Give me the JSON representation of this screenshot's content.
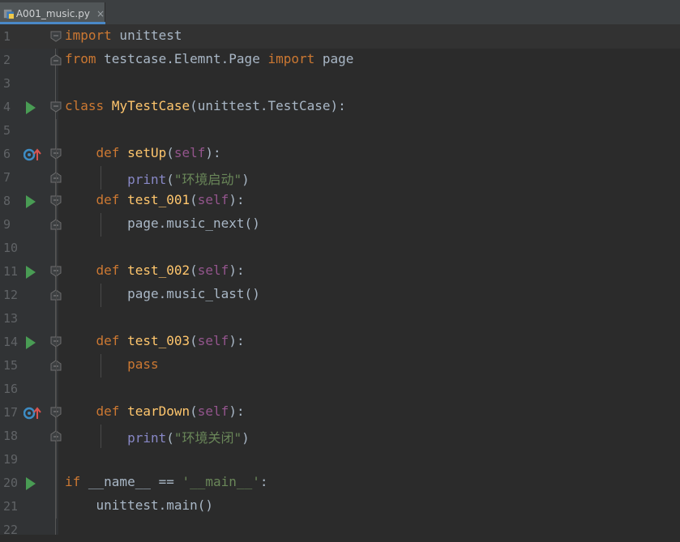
{
  "tab": {
    "file_name": "A001_music.py",
    "close_glyph": "×"
  },
  "colors": {
    "keyword": "#cc7832",
    "function": "#ffc66d",
    "self": "#94558d",
    "string": "#6a8759",
    "text": "#a9b7c6",
    "run": "#499c54"
  },
  "lines": [
    {
      "num": "1",
      "parts": [
        [
          "kw",
          "import"
        ],
        [
          "",
          " unittest"
        ]
      ]
    },
    {
      "num": "2",
      "parts": [
        [
          "kw",
          "from"
        ],
        [
          "",
          " testcase.Elemnt.Page "
        ],
        [
          "kw",
          "import"
        ],
        [
          "",
          " page"
        ]
      ]
    },
    {
      "num": "3",
      "parts": []
    },
    {
      "num": "4",
      "parts": [
        [
          "kw",
          "class"
        ],
        [
          "",
          " "
        ],
        [
          "fn",
          "MyTestCase"
        ],
        [
          "",
          "(unittest.TestCase):"
        ]
      ]
    },
    {
      "num": "5",
      "parts": []
    },
    {
      "num": "6",
      "parts": [
        [
          "",
          "    "
        ],
        [
          "kw",
          "def"
        ],
        [
          "",
          " "
        ],
        [
          "fn",
          "setUp"
        ],
        [
          "",
          "("
        ],
        [
          "self",
          "self"
        ],
        [
          "",
          "):"
        ]
      ]
    },
    {
      "num": "7",
      "parts": [
        [
          "",
          "        "
        ],
        [
          "builtin",
          "print"
        ],
        [
          "",
          "("
        ],
        [
          "str",
          "\"环境启动\""
        ],
        [
          "",
          ")"
        ]
      ]
    },
    {
      "num": "8",
      "parts": [
        [
          "",
          "    "
        ],
        [
          "kw",
          "def"
        ],
        [
          "",
          " "
        ],
        [
          "fn",
          "test_001"
        ],
        [
          "",
          "("
        ],
        [
          "self",
          "self"
        ],
        [
          "",
          "):"
        ]
      ]
    },
    {
      "num": "9",
      "parts": [
        [
          "",
          "        page.music_next("
        ],
        [
          "",
          ")"
        ]
      ]
    },
    {
      "num": "10",
      "parts": []
    },
    {
      "num": "11",
      "parts": [
        [
          "",
          "    "
        ],
        [
          "kw",
          "def"
        ],
        [
          "",
          " "
        ],
        [
          "fn",
          "test_002"
        ],
        [
          "",
          "("
        ],
        [
          "self",
          "self"
        ],
        [
          "",
          "):"
        ]
      ]
    },
    {
      "num": "12",
      "parts": [
        [
          "",
          "        page.music_last("
        ],
        [
          "",
          ")"
        ]
      ]
    },
    {
      "num": "13",
      "parts": []
    },
    {
      "num": "14",
      "parts": [
        [
          "",
          "    "
        ],
        [
          "kw",
          "def"
        ],
        [
          "",
          " "
        ],
        [
          "fn",
          "test_003"
        ],
        [
          "",
          "("
        ],
        [
          "self",
          "self"
        ],
        [
          "",
          "):"
        ]
      ]
    },
    {
      "num": "15",
      "parts": [
        [
          "",
          "        "
        ],
        [
          "kw",
          "pass"
        ]
      ]
    },
    {
      "num": "16",
      "parts": []
    },
    {
      "num": "17",
      "parts": [
        [
          "",
          "    "
        ],
        [
          "kw",
          "def"
        ],
        [
          "",
          " "
        ],
        [
          "fn",
          "tearDown"
        ],
        [
          "",
          "("
        ],
        [
          "self",
          "self"
        ],
        [
          "",
          "):"
        ]
      ]
    },
    {
      "num": "18",
      "parts": [
        [
          "",
          "        "
        ],
        [
          "builtin",
          "print"
        ],
        [
          "",
          "("
        ],
        [
          "str",
          "\"环境关闭\""
        ],
        [
          "",
          ")"
        ]
      ]
    },
    {
      "num": "19",
      "parts": []
    },
    {
      "num": "20",
      "parts": [
        [
          "kw",
          "if"
        ],
        [
          "",
          " __name__ == "
        ],
        [
          "str",
          "'__main__'"
        ],
        [
          "",
          ":"
        ]
      ]
    },
    {
      "num": "21",
      "parts": [
        [
          "",
          "    unittest.main()"
        ]
      ]
    },
    {
      "num": "22",
      "parts": []
    }
  ],
  "gutter_markers": {
    "run": [
      "4",
      "8",
      "11",
      "14",
      "20"
    ],
    "override": [
      "6",
      "17"
    ]
  }
}
